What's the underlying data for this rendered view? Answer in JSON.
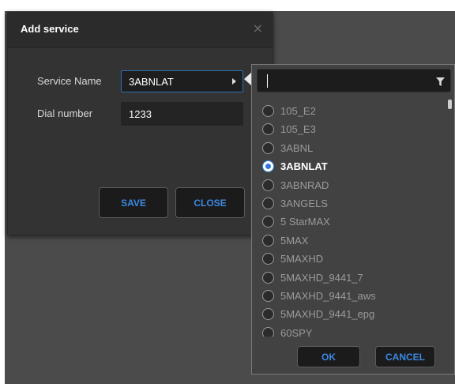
{
  "dialog": {
    "title": "Add service",
    "close_glyph": "×",
    "service_name_label": "Service Name",
    "service_name_value": "3ABNLAT",
    "dial_number_label": "Dial number",
    "dial_number_value": "1233",
    "save_label": "SAVE",
    "close_label": "CLOSE"
  },
  "dropdown": {
    "filter_value": "",
    "filter_icon": "filter-icon",
    "selected": "3ABNLAT",
    "items": [
      "105_E2",
      "105_E3",
      "3ABNL",
      "3ABNLAT",
      "3ABNRAD",
      "3ANGELS",
      "5 StarMAX",
      "5MAX",
      "5MAXHD",
      "5MAXHD_9441_7",
      "5MAXHD_9441_aws",
      "5MAXHD_9441_epg",
      "60SPY"
    ],
    "ok_label": "OK",
    "cancel_label": "CANCEL"
  },
  "colors": {
    "accent": "#3c88e0",
    "dialog_bg": "#333333",
    "backdrop": "#4b4b4b",
    "popup_bg": "#424242"
  }
}
